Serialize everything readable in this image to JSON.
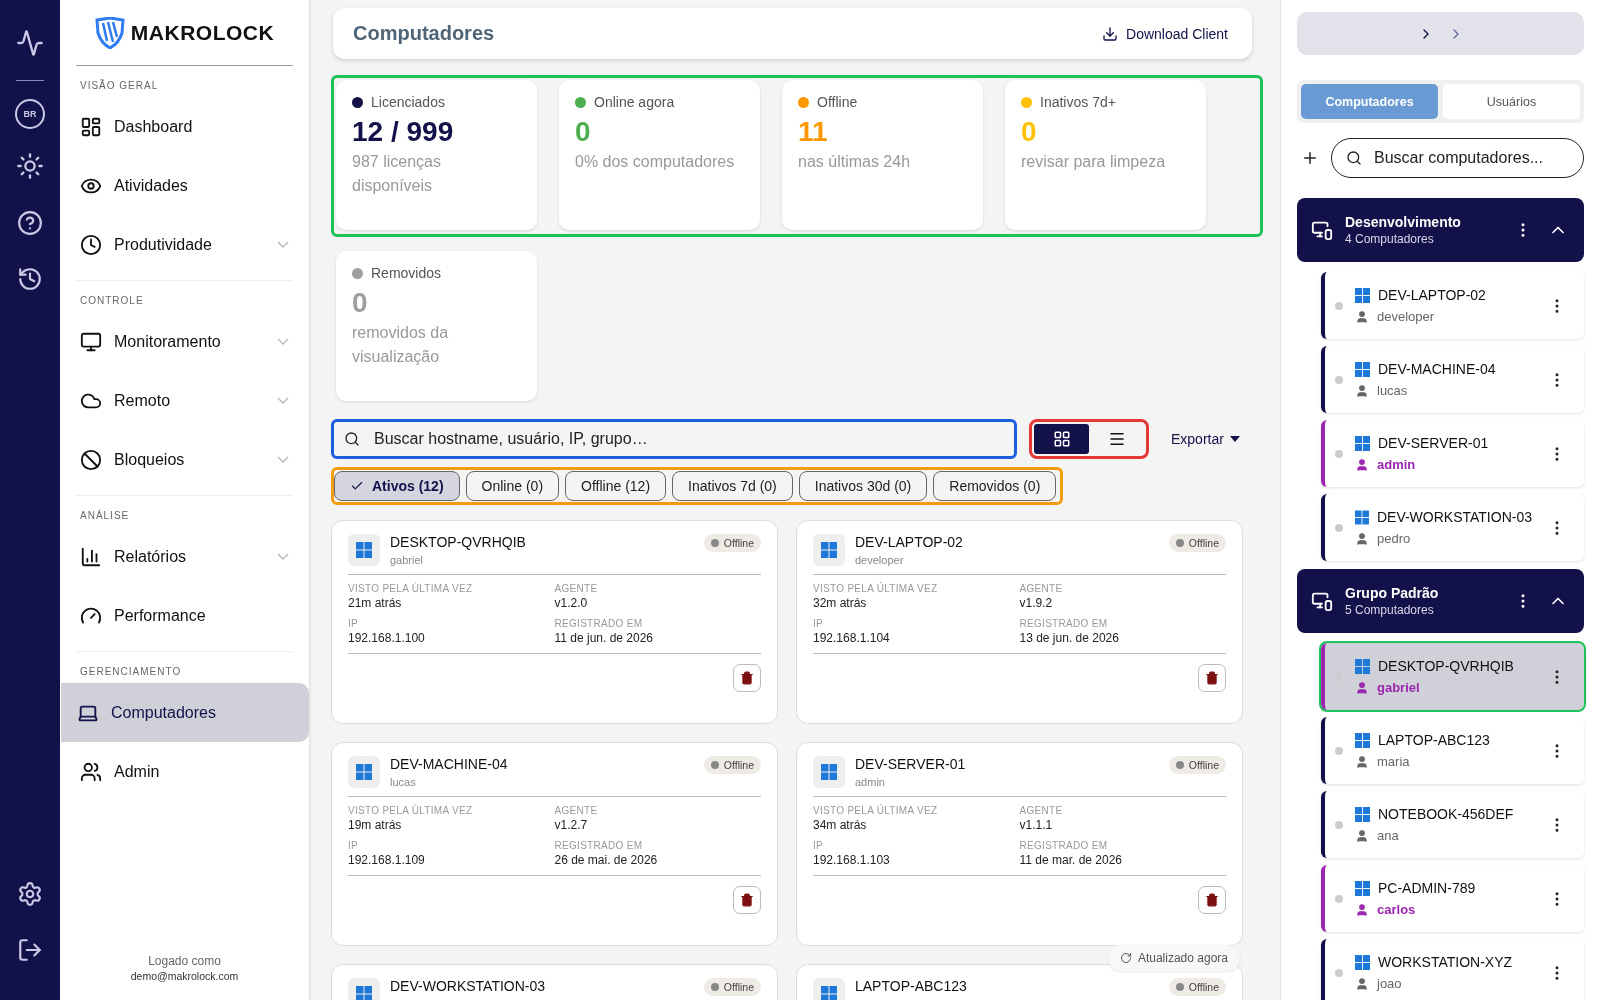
{
  "rail": {
    "locale": "BR"
  },
  "brand": {
    "name": "MAKROLOCK"
  },
  "sidebar": {
    "sections": [
      {
        "title": "VISÃO GERAL",
        "items": [
          {
            "label": "Dashboard",
            "expandable": false,
            "selected": false
          },
          {
            "label": "Atividades",
            "expandable": false,
            "selected": false
          },
          {
            "label": "Produtividade",
            "expandable": true,
            "selected": false
          }
        ]
      },
      {
        "title": "CONTROLE",
        "items": [
          {
            "label": "Monitoramento",
            "expandable": true,
            "selected": false
          },
          {
            "label": "Remoto",
            "expandable": true,
            "selected": false
          },
          {
            "label": "Bloqueios",
            "expandable": true,
            "selected": false
          }
        ]
      },
      {
        "title": "ANÁLISE",
        "items": [
          {
            "label": "Relatórios",
            "expandable": true,
            "selected": false
          },
          {
            "label": "Performance",
            "expandable": false,
            "selected": false
          }
        ]
      },
      {
        "title": "GERENCIAMENTO",
        "items": [
          {
            "label": "Computadores",
            "expandable": false,
            "selected": true
          },
          {
            "label": "Admin",
            "expandable": false,
            "selected": false
          }
        ]
      }
    ],
    "footer": {
      "caption": "Logado como",
      "email": "demo@makrolock.com"
    }
  },
  "header": {
    "title": "Computadores",
    "action": "Download Client"
  },
  "stats": [
    {
      "label": "Licenciados",
      "value": "12 / 999",
      "subtitle": "987 licenças disponíveis",
      "color": "#12114a"
    },
    {
      "label": "Online agora",
      "value": "0",
      "subtitle": "0% dos computadores",
      "color": "#4caf50"
    },
    {
      "label": "Offline",
      "value": "11",
      "subtitle": "nas últimas 24h",
      "color": "#ff9800"
    },
    {
      "label": "Inativos 7d+",
      "value": "0",
      "subtitle": "revisar para limpeza",
      "color": "#ffc107"
    },
    {
      "label": "Removidos",
      "value": "0",
      "subtitle": "removidos da visualização",
      "color": "#9e9e9e"
    }
  ],
  "search": {
    "placeholder": "Buscar hostname, usuário, IP, grupo…"
  },
  "view_toggle": [
    {
      "kind": "grid",
      "selected": true
    },
    {
      "kind": "list",
      "selected": false
    }
  ],
  "export": {
    "label": "Exportar"
  },
  "filters": [
    {
      "label": "Ativos (12)",
      "selected": true
    },
    {
      "label": "Online (0)",
      "selected": false
    },
    {
      "label": "Offline (12)",
      "selected": false
    },
    {
      "label": "Inativos 7d (0)",
      "selected": false
    },
    {
      "label": "Inativos 30d (0)",
      "selected": false
    },
    {
      "label": "Removidos (0)",
      "selected": false
    }
  ],
  "computers": [
    {
      "hostname": "DESKTOP-QVRHQIB",
      "user": "gabriel",
      "status": "Offline",
      "seen_label": "VISTO PELA ÚLTIMA VEZ",
      "seen": "21m atrás",
      "agent_label": "AGENTE",
      "agent": "v1.2.0",
      "ip_label": "IP",
      "ip": "192.168.1.100",
      "registered_label": "REGISTRADO EM",
      "registered": "11 de jun. de 2026"
    },
    {
      "hostname": "DEV-LAPTOP-02",
      "user": "developer",
      "status": "Offline",
      "seen_label": "VISTO PELA ÚLTIMA VEZ",
      "seen": "32m atrás",
      "agent_label": "AGENTE",
      "agent": "v1.9.2",
      "ip_label": "IP",
      "ip": "192.168.1.104",
      "registered_label": "REGISTRADO EM",
      "registered": "13 de jun. de 2026"
    },
    {
      "hostname": "DEV-MACHINE-04",
      "user": "lucas",
      "status": "Offline",
      "seen_label": "VISTO PELA ÚLTIMA VEZ",
      "seen": "19m atrás",
      "agent_label": "AGENTE",
      "agent": "v1.2.7",
      "ip_label": "IP",
      "ip": "192.168.1.109",
      "registered_label": "REGISTRADO EM",
      "registered": "26 de mai. de 2026"
    },
    {
      "hostname": "DEV-SERVER-01",
      "user": "admin",
      "status": "Offline",
      "seen_label": "VISTO PELA ÚLTIMA VEZ",
      "seen": "34m atrás",
      "agent_label": "AGENTE",
      "agent": "v1.1.1",
      "ip_label": "IP",
      "ip": "192.168.1.103",
      "registered_label": "REGISTRADO EM",
      "registered": "11 de mar. de 2026"
    },
    {
      "hostname": "DEV-WORKSTATION-03",
      "status": "Offline"
    },
    {
      "hostname": "LAPTOP-ABC123",
      "status": "Offline"
    }
  ],
  "refresh_toast": "Atualizado agora",
  "panel": {
    "tabs": [
      {
        "label": "Computadores",
        "selected": true
      },
      {
        "label": "Usuários",
        "selected": false
      }
    ],
    "search": {
      "placeholder": "Buscar computadores..."
    },
    "groups": [
      {
        "name": "Desenvolvimento",
        "count": "4 Computadores",
        "expanded": true,
        "items": [
          {
            "hostname": "DEV-LAPTOP-02",
            "user": "developer",
            "kind": "user",
            "selected": false
          },
          {
            "hostname": "DEV-MACHINE-04",
            "user": "lucas",
            "kind": "user",
            "selected": false
          },
          {
            "hostname": "DEV-SERVER-01",
            "user": "admin",
            "kind": "admin",
            "selected": false
          },
          {
            "hostname": "DEV-WORKSTATION-03",
            "user": "pedro",
            "kind": "user",
            "selected": false
          }
        ]
      },
      {
        "name": "Grupo Padrão",
        "count": "5 Computadores",
        "expanded": true,
        "items": [
          {
            "hostname": "DESKTOP-QVRHQIB",
            "user": "gabriel",
            "kind": "admin",
            "selected": true
          },
          {
            "hostname": "LAPTOP-ABC123",
            "user": "maria",
            "kind": "user",
            "selected": false
          },
          {
            "hostname": "NOTEBOOK-456DEF",
            "user": "ana",
            "kind": "user",
            "selected": false
          },
          {
            "hostname": "PC-ADMIN-789",
            "user": "carlos",
            "kind": "admin",
            "selected": false
          },
          {
            "hostname": "WORKSTATION-XYZ",
            "user": "joao",
            "kind": "user",
            "selected": false
          }
        ]
      }
    ]
  }
}
